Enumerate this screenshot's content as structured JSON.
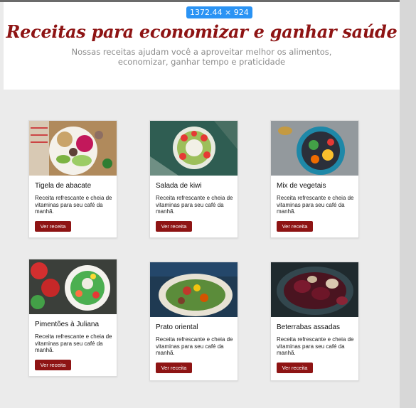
{
  "overlay": {
    "dimensions_label": "1372.44 × 924"
  },
  "header": {
    "title": "Receitas para economizar e ganhar saúde",
    "subtitle": "Nossas receitas ajudam você a aproveitar melhor os alimentos, economizar, ganhar tempo e praticidade"
  },
  "recipes": [
    {
      "name": "Tigela de abacate",
      "description": "Receita refrescante e cheia de vitaminas para seu café da manhã.",
      "button": "Ver receita",
      "image": "avocado-bowl-photo"
    },
    {
      "name": "Salada de kiwi",
      "description": "Receita refrescante e cheia de vitaminas para seu café da manhã.",
      "button": "Ver receita",
      "image": "kiwi-salad-photo"
    },
    {
      "name": "Mix de vegetais",
      "description": "Receita refrescante e cheia de vitaminas para seu café da manhã.",
      "button": "Ver receita",
      "image": "vegetable-mix-photo"
    },
    {
      "name": "Pimentões à Juliana",
      "description": "Receita refrescante e cheia de vitaminas para seu café da manhã.",
      "button": "Ver receita",
      "image": "peppers-julienne-photo"
    },
    {
      "name": "Prato oriental",
      "description": "Receita refrescante e cheia de vitaminas para seu café da manhã.",
      "button": "Ver receita",
      "image": "oriental-dish-photo"
    },
    {
      "name": "Beterrabas assadas",
      "description": "Receita refrescante e cheia de vitaminas para seu café da manhã.",
      "button": "Ver receita",
      "image": "roasted-beets-photo"
    }
  ],
  "colors": {
    "accent": "#8e1414",
    "overlay_badge": "#2a93f4",
    "background": "#ebebeb"
  }
}
